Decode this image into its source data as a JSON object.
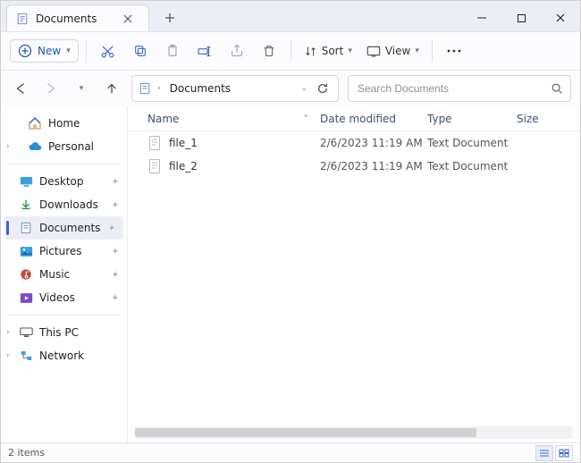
{
  "tab": {
    "title": "Documents"
  },
  "toolbar": {
    "new_label": "New",
    "sort_label": "Sort",
    "view_label": "View"
  },
  "breadcrumb": {
    "current": "Documents"
  },
  "search": {
    "placeholder": "Search Documents"
  },
  "sidebar": {
    "home": "Home",
    "personal": "Personal",
    "desktop": "Desktop",
    "downloads": "Downloads",
    "documents": "Documents",
    "pictures": "Pictures",
    "music": "Music",
    "videos": "Videos",
    "this_pc": "This PC",
    "network": "Network"
  },
  "columns": {
    "name": "Name",
    "date": "Date modified",
    "type": "Type",
    "size": "Size"
  },
  "files": [
    {
      "name": "file_1",
      "date": "2/6/2023 11:19 AM",
      "type": "Text Document",
      "size": ""
    },
    {
      "name": "file_2",
      "date": "2/6/2023 11:19 AM",
      "type": "Text Document",
      "size": ""
    }
  ],
  "status": {
    "item_count": "2 items"
  }
}
